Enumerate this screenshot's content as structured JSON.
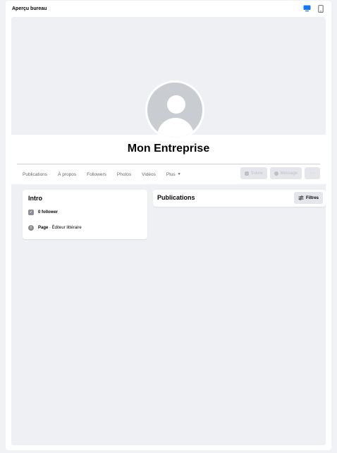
{
  "topbar": {
    "title": "Aperçu bureau",
    "icons": [
      "desktop-icon",
      "mobile-icon"
    ],
    "active_color": "#1877f2"
  },
  "profile": {
    "name": "Mon Entreprise",
    "tabs": [
      {
        "label": "Publications"
      },
      {
        "label": "À propos"
      },
      {
        "label": "Followers"
      },
      {
        "label": "Photos"
      },
      {
        "label": "Vidéos"
      },
      {
        "label": "Plus"
      }
    ],
    "actions": {
      "follow": "Suivre",
      "message": "Message",
      "more": "···"
    }
  },
  "intro": {
    "title": "Intro",
    "followers": "0 follower",
    "page_label": "Page",
    "page_category": " · Éditeur littéraire"
  },
  "posts": {
    "title": "Publications",
    "filter_label": "Filtres"
  }
}
